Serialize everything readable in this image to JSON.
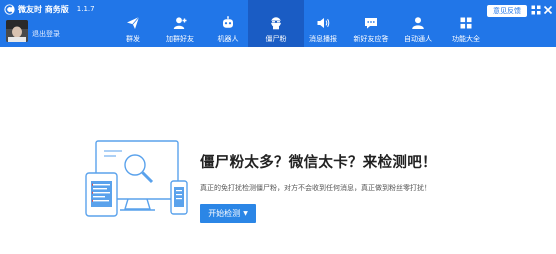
{
  "app": {
    "name": "微友时 商务版",
    "version": "1.1.7",
    "logout_label": "退出登录"
  },
  "nav": [
    {
      "label": "群发",
      "icon": "paper-plane-icon"
    },
    {
      "label": "加群好友",
      "icon": "add-user-icon"
    },
    {
      "label": "机器人",
      "icon": "robot-icon"
    },
    {
      "label": "僵尸粉",
      "icon": "zombie-fans-icon",
      "active": true
    },
    {
      "label": "消息播报",
      "icon": "speaker-icon"
    },
    {
      "label": "新好友应答",
      "icon": "chat-bubble-icon"
    },
    {
      "label": "自动通人",
      "icon": "auto-user-icon"
    },
    {
      "label": "功能大全",
      "icon": "feature-grid-icon"
    }
  ],
  "feedback_label": "意见反馈",
  "main": {
    "headline": "僵尸粉太多？微信太卡？来检测吧！",
    "description": "真正的免打扰检测僵尸粉，对方不会收到任何消息，真正做到粉丝零打扰！",
    "start_button_label": "开始检测"
  },
  "colors": {
    "topbar": "#2176e8",
    "active_tab": "#1a5cc4",
    "button": "#2b86e6",
    "illustration": "#5aa2ec"
  }
}
